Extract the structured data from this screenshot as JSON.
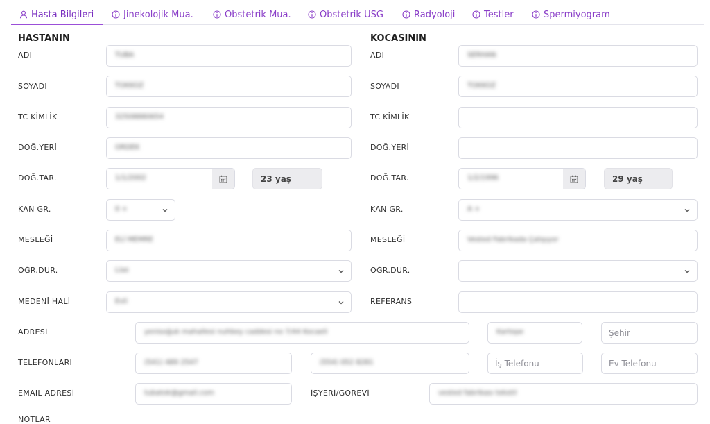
{
  "tabs": [
    {
      "label": "Hasta Bilgileri",
      "icon": "user-icon"
    },
    {
      "label": "Jinekolojik Mua.",
      "icon": "info-icon"
    },
    {
      "label": "Obstetrik Mua.",
      "icon": "info-icon"
    },
    {
      "label": "Obstetrik USG",
      "icon": "info-icon"
    },
    {
      "label": "Radyoloji",
      "icon": "info-icon"
    },
    {
      "label": "Testler",
      "icon": "info-icon"
    },
    {
      "label": "Spermiyogram",
      "icon": "info-icon"
    }
  ],
  "colors": {
    "accent": "#9b4fd8",
    "tab_text": "#8a3ec8",
    "border": "#dadbe3",
    "readonly_bg": "#ececef"
  },
  "patient": {
    "heading": "HASTANIN",
    "labels": {
      "name": "ADI",
      "surname": "SOYADI",
      "tc": "TC KİMLİK",
      "birthplace": "DOĞ.YERİ",
      "birthdate": "DOĞ.TAR.",
      "blood": "KAN GR.",
      "job": "MESLEĞİ",
      "education": "ÖĞR.DUR.",
      "marital": "MEDENİ HALİ"
    },
    "values": {
      "name": "TUBA",
      "surname": "TOKKOZ",
      "tc": "32508880654",
      "birthplace": "ORDEK",
      "birthdate": "1/1/2002",
      "blood": "0 +",
      "job": "ELİ MEMRE",
      "education": "Lise",
      "marital": "Evli"
    },
    "age": "23 yaş"
  },
  "husband": {
    "heading": "KOCASININ",
    "labels": {
      "name": "ADI",
      "surname": "SOYADI",
      "tc": "TC KİMLİK",
      "birthplace": "DOĞ.YERİ",
      "birthdate": "DOĞ.TAR.",
      "blood": "KAN GR.",
      "job": "MESLEĞİ",
      "education": "ÖĞR.DUR.",
      "reference": "REFERANS"
    },
    "values": {
      "name": "SERHAN",
      "surname": "TOKKOZ",
      "tc": "",
      "birthplace": "",
      "birthdate": "1/2/1996",
      "blood": "A +",
      "job": "Vested Fabrikada Çalışıyor",
      "education": "",
      "reference": ""
    },
    "age": "29 yaş"
  },
  "contact": {
    "labels": {
      "address": "ADRESİ",
      "phones": "TELEFONLARI",
      "email": "EMAIL ADRESİ",
      "workplace": "İŞYERİ/GÖREVİ",
      "notes": "NOTLAR"
    },
    "address": "yenisoğuk mahallesi nuhbey caddesi no 7/44 Kocaeli",
    "district": "Kartepe",
    "city_placeholder": "Şehir",
    "phone1": "(541) 489 2547",
    "phone2": "(554) 052 8281",
    "work_phone_placeholder": "İş Telefonu",
    "home_phone_placeholder": "Ev Telefonu",
    "email": "tubatok@gmail.com",
    "workplace": "vested fabrikası tekstil"
  }
}
